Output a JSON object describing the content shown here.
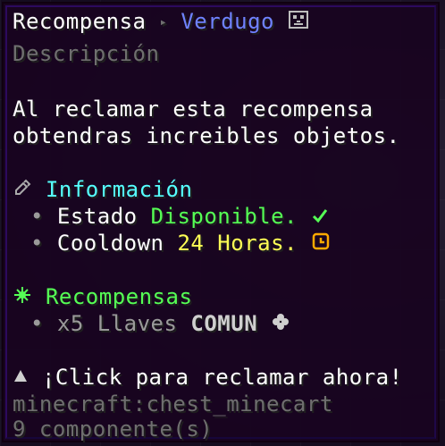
{
  "title": {
    "name": "Recompensa",
    "separator": "▸",
    "rank": "Verdugo",
    "rank_icon": "skull-icon"
  },
  "subtitle": "Descripción",
  "description": [
    "Al reclamar esta recompensa",
    "obtendras increibles objetos."
  ],
  "info": {
    "header_icon": "pencil-icon",
    "header": "Información",
    "rows": [
      {
        "bullet": "•",
        "label": "Estado",
        "value": "Disponible.",
        "value_icon": "checkmark-icon"
      },
      {
        "bullet": "•",
        "label": "Cooldown",
        "value": "24 Horas.",
        "value_icon": "clock-icon"
      }
    ]
  },
  "rewards": {
    "header_icon": "sparkle-icon",
    "header": "Recompensas",
    "items": [
      {
        "bullet": "•",
        "text": "x5 Llaves",
        "tier": "COMUN",
        "tier_icon": "clover-icon"
      }
    ]
  },
  "action": {
    "icon": "up-arrow-icon",
    "label": "¡Click para reclamar ahora!"
  },
  "item_id": "minecraft:chest_minecart",
  "components": "9 componente(s)",
  "colors": {
    "background": "#180420",
    "border": "#2c0a5e",
    "title": "#ffffff",
    "rank": "#6f82ff",
    "info_header": "#55ffff",
    "rewards_header": "#55ff55",
    "available": "#55ff55",
    "cooldown": "#ffff55",
    "muted": "#9a9a9a"
  }
}
